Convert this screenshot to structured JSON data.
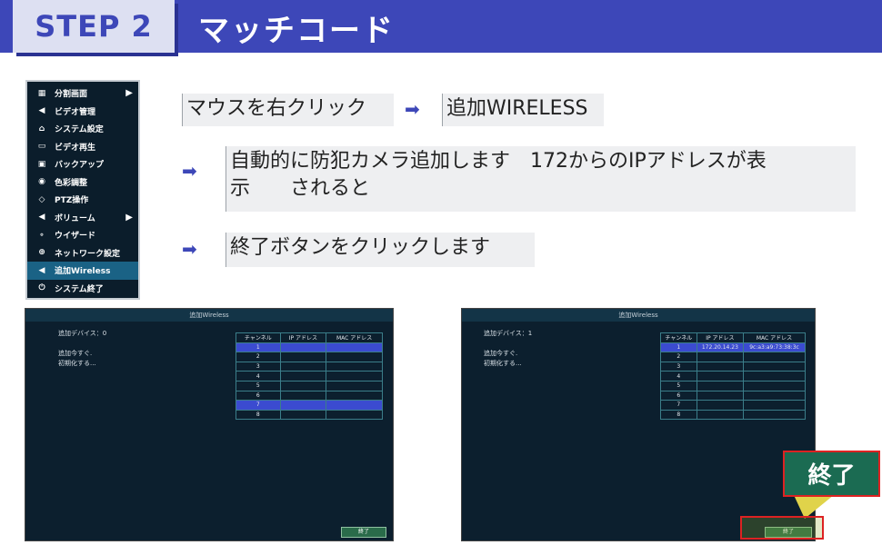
{
  "header": {
    "step": "STEP 2",
    "title": "マッチコード"
  },
  "menu": {
    "items": [
      {
        "icon": "▦",
        "label": "分割画面",
        "submenu": true
      },
      {
        "icon": "◀",
        "label": "ビデオ管理",
        "submenu": false
      },
      {
        "icon": "⌂",
        "label": "システム設定",
        "submenu": false
      },
      {
        "icon": "▭",
        "label": "ビデオ再生",
        "submenu": false
      },
      {
        "icon": "▣",
        "label": "バックアップ",
        "submenu": false
      },
      {
        "icon": "◉",
        "label": "色彩調整",
        "submenu": false
      },
      {
        "icon": "◇",
        "label": "PTZ操作",
        "submenu": false
      },
      {
        "icon": "◀",
        "label": "ボリューム",
        "submenu": true
      },
      {
        "icon": "∘",
        "label": "ウイザード",
        "submenu": false
      },
      {
        "icon": "⊕",
        "label": "ネットワーク設定",
        "submenu": false
      },
      {
        "icon": "◀",
        "label": "追加Wireless",
        "submenu": false,
        "selected": true
      },
      {
        "icon": "⏻",
        "label": "システム終了",
        "submenu": false
      }
    ]
  },
  "instructions": {
    "step1_a": "マウスを右クリック",
    "step1_b": "追加WIRELESS",
    "step2_line1": "自動的に防犯カメラ追加します　172からのIPアドレスが表",
    "step2_line2": "示　　されると",
    "step3": "終了ボタンをクリックします"
  },
  "dialog_left": {
    "title": "追加Wireless",
    "device_label": "追加デバイス：",
    "device_count": "0",
    "status_line1": "追加今すぐ.",
    "status_line2": "初期化する...",
    "columns": [
      "チャンネル",
      "IP アドレス",
      "MAC アドレス"
    ],
    "rows": [
      {
        "ch": "1",
        "ip": "",
        "mac": ""
      },
      {
        "ch": "2",
        "ip": "",
        "mac": ""
      },
      {
        "ch": "3",
        "ip": "",
        "mac": ""
      },
      {
        "ch": "4",
        "ip": "",
        "mac": ""
      },
      {
        "ch": "5",
        "ip": "",
        "mac": ""
      },
      {
        "ch": "6",
        "ip": "",
        "mac": ""
      },
      {
        "ch": "7",
        "ip": "",
        "mac": ""
      },
      {
        "ch": "8",
        "ip": "",
        "mac": ""
      }
    ],
    "finish_button": "終了"
  },
  "dialog_right": {
    "title": "追加Wireless",
    "device_label": "追加デバイス：",
    "device_count": "1",
    "status_line1": "追加今すぐ.",
    "status_line2": "初期化する...",
    "columns": [
      "チャンネル",
      "IP アドレス",
      "MAC アドレス"
    ],
    "rows": [
      {
        "ch": "1",
        "ip": "172.20.14.23",
        "mac": "9c:a3:a9:73:38:3c"
      },
      {
        "ch": "2",
        "ip": "",
        "mac": ""
      },
      {
        "ch": "3",
        "ip": "",
        "mac": ""
      },
      {
        "ch": "4",
        "ip": "",
        "mac": ""
      },
      {
        "ch": "5",
        "ip": "",
        "mac": ""
      },
      {
        "ch": "6",
        "ip": "",
        "mac": ""
      },
      {
        "ch": "7",
        "ip": "",
        "mac": ""
      },
      {
        "ch": "8",
        "ip": "",
        "mac": ""
      }
    ],
    "finish_button": "終了",
    "callout": "終了"
  },
  "colors": {
    "brand": "#3d47b8",
    "dialog_bg": "#0c1f2e",
    "row_highlight": "#3b4bd0",
    "callout_border": "#dd2222"
  }
}
